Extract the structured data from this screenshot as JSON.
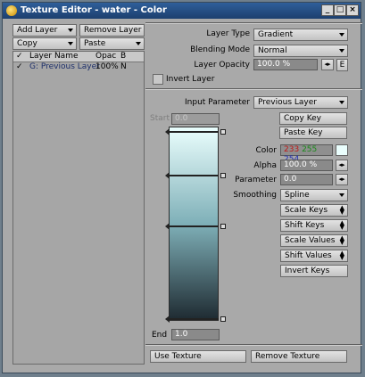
{
  "window": {
    "title": "Texture Editor - water - Color",
    "min_glyph": "_",
    "max_glyph": "□",
    "close_glyph": "×"
  },
  "left": {
    "add_layer": "Add Layer",
    "remove_layer": "Remove Layer",
    "copy": "Copy",
    "paste": "Paste",
    "list_headers": {
      "check": "✓",
      "name": "Layer Name",
      "opac": "Opac",
      "b": "B"
    },
    "layers": [
      {
        "check": "✓",
        "name": "G: Previous Layer",
        "opac": "100%",
        "b": "N"
      }
    ]
  },
  "layer": {
    "type_label": "Layer Type",
    "type_value": "Gradient",
    "blend_label": "Blending Mode",
    "blend_value": "Normal",
    "opacity_label": "Layer Opacity",
    "opacity_value": "100.0 %",
    "arrows_glyph": "◂▸",
    "e_label": "E",
    "invert_label": "Invert Layer"
  },
  "gradient": {
    "input_label": "Input Parameter",
    "input_value": "Previous Layer",
    "start_label": "Start",
    "start_value": "0.0",
    "end_label": "End",
    "end_value": "1.0",
    "copy_key": "Copy Key",
    "paste_key": "Paste Key",
    "color_label": "Color",
    "color_r": "233",
    "color_g": "255",
    "color_b": "254",
    "alpha_label": "Alpha",
    "alpha_value": "100.0 %",
    "param_label": "Parameter",
    "param_value": "0.0",
    "smooth_label": "Smoothing",
    "smooth_value": "Spline",
    "scale_keys": "Scale Keys",
    "shift_keys": "Shift Keys",
    "scale_values": "Scale Values",
    "shift_values": "Shift Values",
    "invert_keys": "Invert Keys",
    "colors": {
      "top": "#eafefd",
      "mid": "#7fb0b8",
      "bottom": "#1e2a31"
    }
  },
  "footer": {
    "use_texture": "Use Texture",
    "remove_texture": "Remove Texture"
  }
}
